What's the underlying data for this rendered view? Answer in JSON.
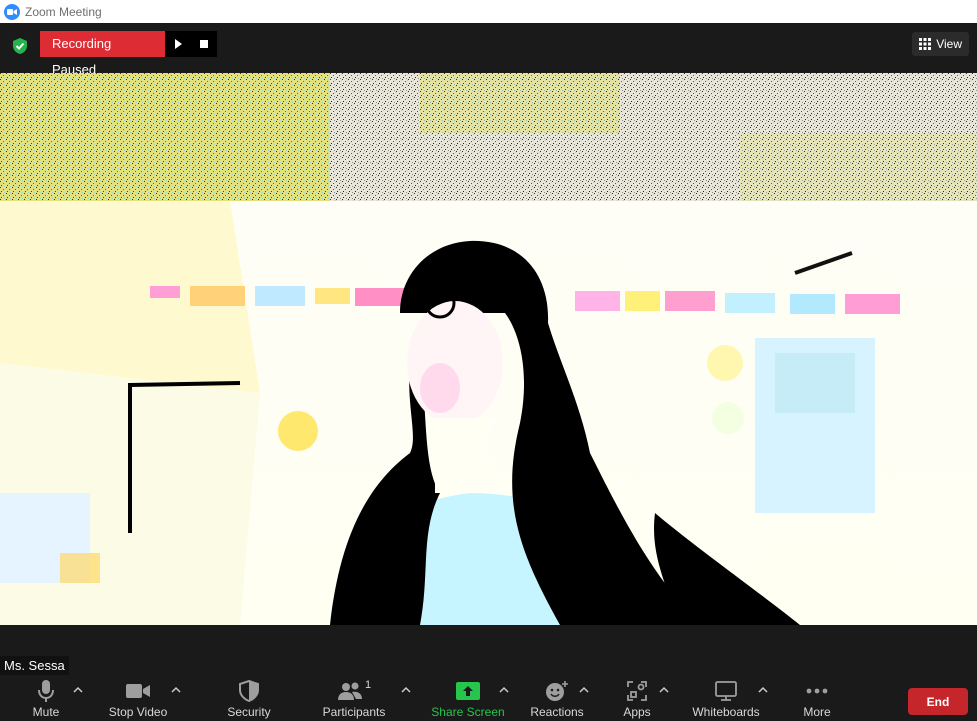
{
  "window": {
    "title": "Zoom Meeting"
  },
  "topbar": {
    "recording_status": "Recording Paused",
    "view_label": "View"
  },
  "participant": {
    "name": "Ms. Sessa"
  },
  "toolbar": {
    "mute": "Mute",
    "stop_video": "Stop Video",
    "security": "Security",
    "participants": "Participants",
    "participants_count": "1",
    "share_screen": "Share Screen",
    "reactions": "Reactions",
    "apps": "Apps",
    "whiteboards": "Whiteboards",
    "more": "More",
    "end": "End"
  },
  "colors": {
    "recording_red": "#de2c34",
    "share_green": "#26c54c",
    "end_red": "#c4262b",
    "zoom_blue": "#2d8cff"
  }
}
